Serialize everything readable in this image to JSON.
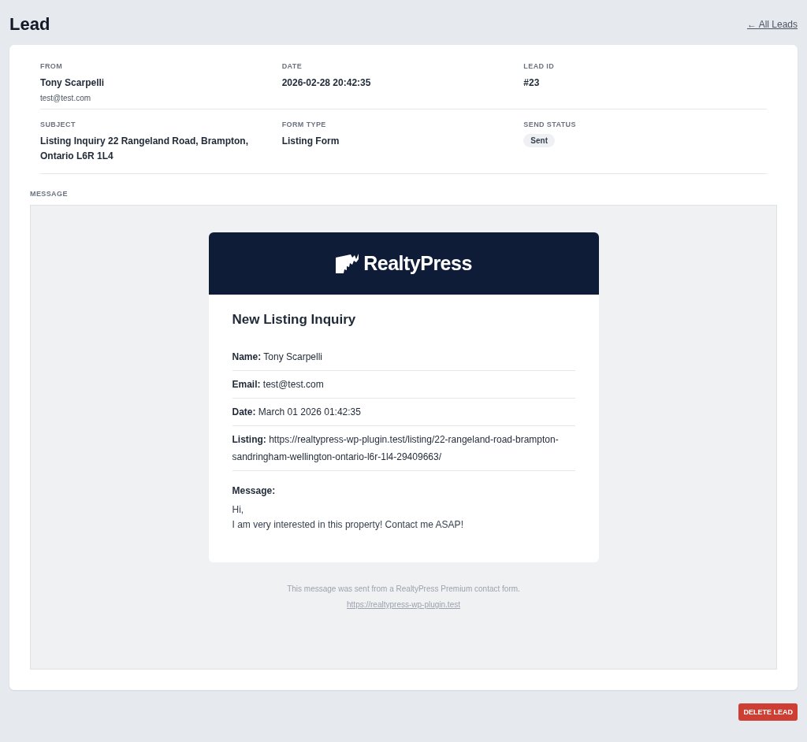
{
  "page_title": "Lead",
  "back_link": "← All Leads",
  "details": [
    {
      "label": "FROM",
      "value": "Tony Scarpelli",
      "sub": "test@test.com"
    },
    {
      "label": "DATE",
      "value": "2026-02-28 20:42:35"
    },
    {
      "label": "LEAD ID",
      "value": "#23"
    },
    {
      "label": "SUBJECT",
      "value": "Listing Inquiry 22 Rangeland Road, Brampton, Ontario L6R 1L4"
    },
    {
      "label": "FORM TYPE",
      "value": "Listing Form"
    },
    {
      "label": "SEND STATUS",
      "badge": "Sent"
    }
  ],
  "message_label": "MESSAGE",
  "email": {
    "logo_text": "RealtyPress",
    "heading": "New Listing Inquiry",
    "fields": [
      "**Name:** Tony Scarpelli",
      "**Email:** test@test.com",
      "**Date:** March 01 2026 01:42:35",
      "**Listing:** https://realtypress-wp-plugin.test/listing/22-rangeland-road-brampton-sandringham-wellington-ontario-l6r-1l4-29409663/"
    ],
    "message_heading": "Message:",
    "message_lines": [
      "Hi,",
      "I am very interested in this property! Contact me ASAP!"
    ],
    "footer_note": "This message was sent from a RealtyPress Premium contact form.",
    "footer_link": "https://realtypress-wp-plugin.test"
  },
  "delete_button": "DELETE LEAD"
}
